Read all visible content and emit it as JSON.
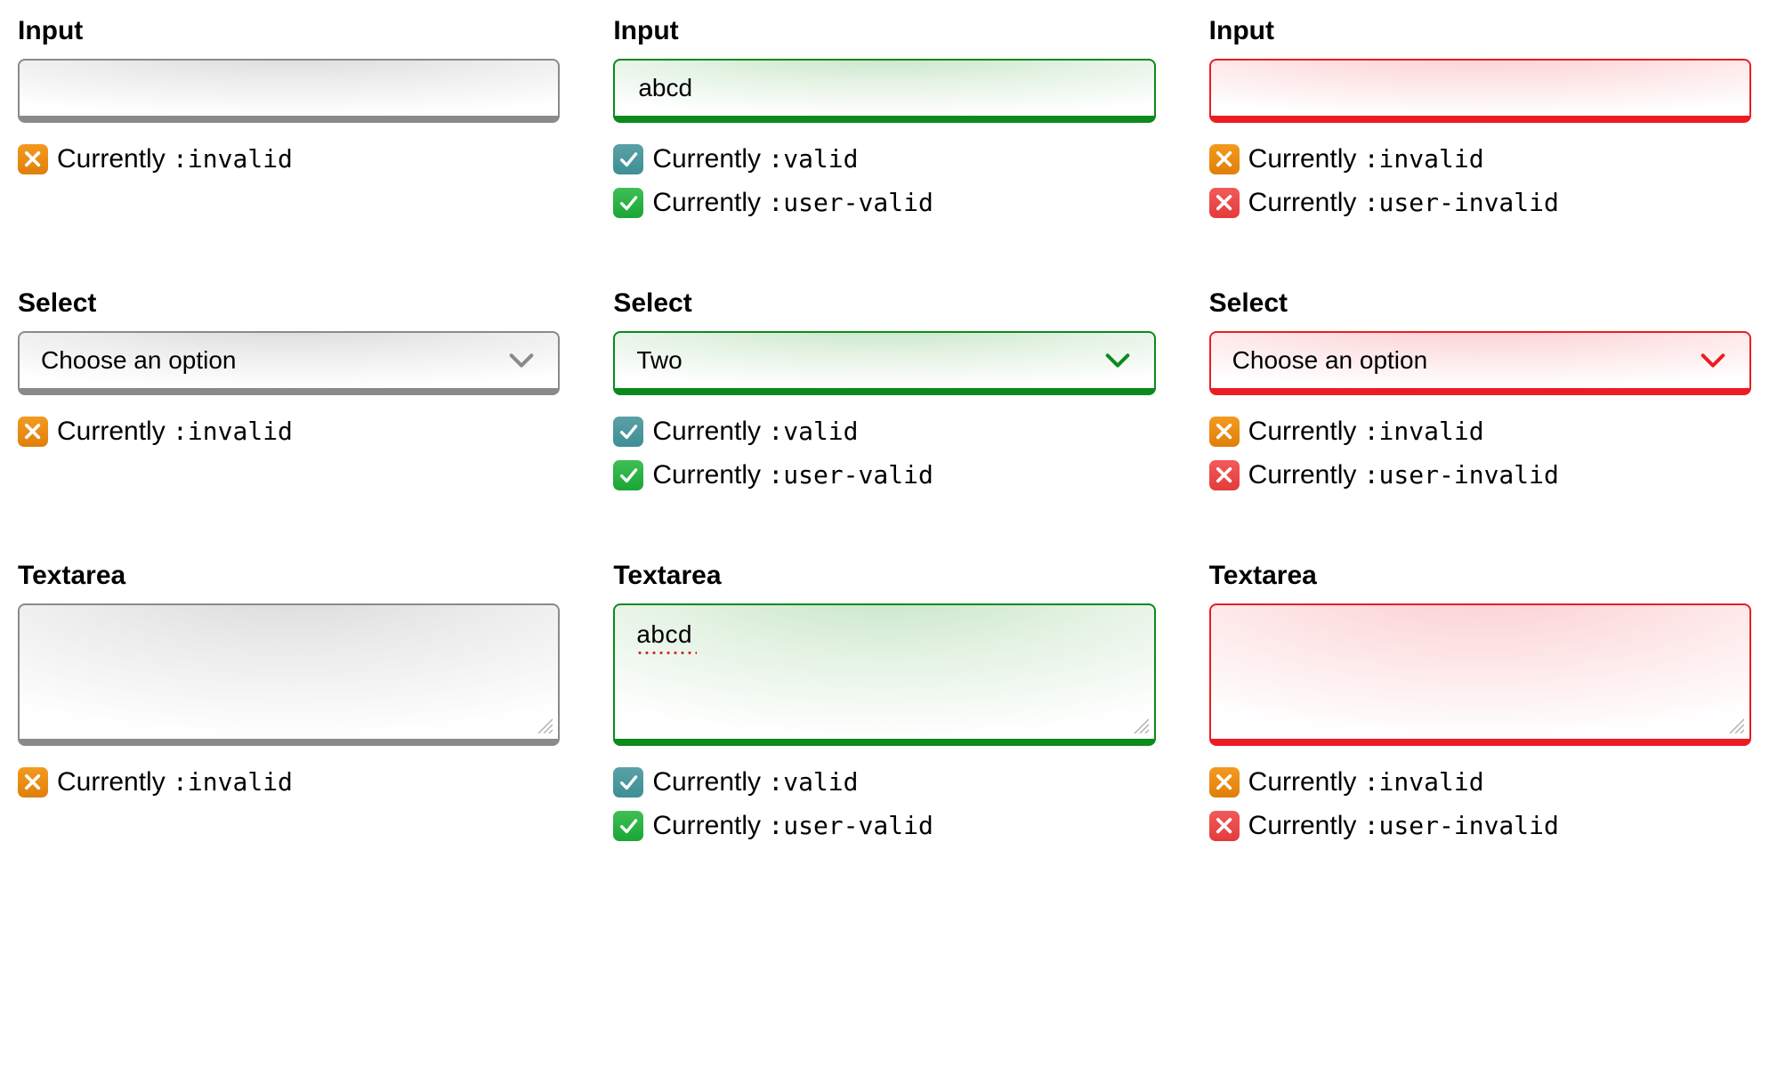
{
  "labels": {
    "input": "Input",
    "select": "Select",
    "textarea": "Textarea"
  },
  "placeholders": {
    "select_default": "Choose an option"
  },
  "values": {
    "input_col2": "abcd",
    "select_col2": "Two",
    "textarea_col2": "abcd"
  },
  "status_prefix": "Currently ",
  "pseudo": {
    "invalid": ":invalid",
    "valid": ":valid",
    "user_valid": ":user-valid",
    "user_invalid": ":user-invalid"
  },
  "icons": {
    "x": "✕",
    "check": "✓"
  }
}
